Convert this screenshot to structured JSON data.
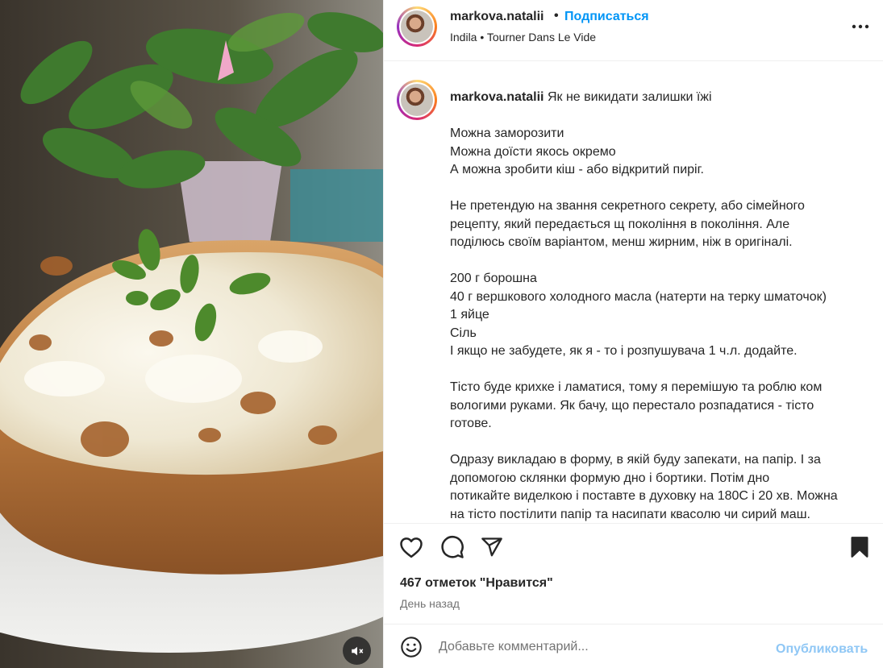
{
  "post": {
    "author": "markova.natalii",
    "separator": "•",
    "follow_label": "Подписаться",
    "audio": "Indila • Tourner Dans Le Vide",
    "more_icon": "more-horizontal-icon"
  },
  "caption": {
    "username": "markova.natalii",
    "title": "Як не викидати залишки їжі",
    "lines": [
      "",
      "Можна заморозити",
      "Можна доїсти якось окремо",
      "А можна зробити кіш - або відкритий пиріг.",
      "",
      "Не претендую на звання секретного секрету, або сімейного",
      "рецепту, який передається щ покоління в покоління. Але",
      "поділюсь своїм варіантом, менш жирним, ніж в оригіналі.",
      "",
      "200 г борошна",
      "40 г вершкового холодного масла (натерти на терку шматочок)",
      "1 яйце",
      "Сіль",
      "І якщо не забудете, як я - то і розпушувача 1 ч.л. додайте.",
      "",
      "Тісто буде крихке і ламатися, тому я перемішую та роблю ком",
      "вологими руками. Як бачу, що перестало розпадатися - тісто",
      "готове.",
      "",
      "Одразу викладаю в форму, в якій буду запекати, на папір. І за",
      "допомогою склянки формую дно і бортики. Потім дно",
      "потикайте виделкою і поставте в духовку на 180С і 20 хв. Можна",
      "на тісто постілити папір та насипати квасолю чи сирий маш."
    ]
  },
  "actions": {
    "like_icon": "heart-icon",
    "comment_icon": "comment-icon",
    "share_icon": "share-icon",
    "save_icon": "bookmark-icon",
    "likes_text": "467 отметок \"Нравится\"",
    "date_text": "День назад"
  },
  "comment": {
    "emoji_icon": "emoji-icon",
    "placeholder": "Добавьте комментарий...",
    "publish_label": "Опубликовать"
  },
  "media": {
    "mute_icon": "speaker-muted-icon",
    "description_colors": {
      "crust": "#b9783d",
      "cheese": "#f3efe2",
      "basil": "#4d8a2c",
      "leaves": "#3f7a2e"
    }
  }
}
